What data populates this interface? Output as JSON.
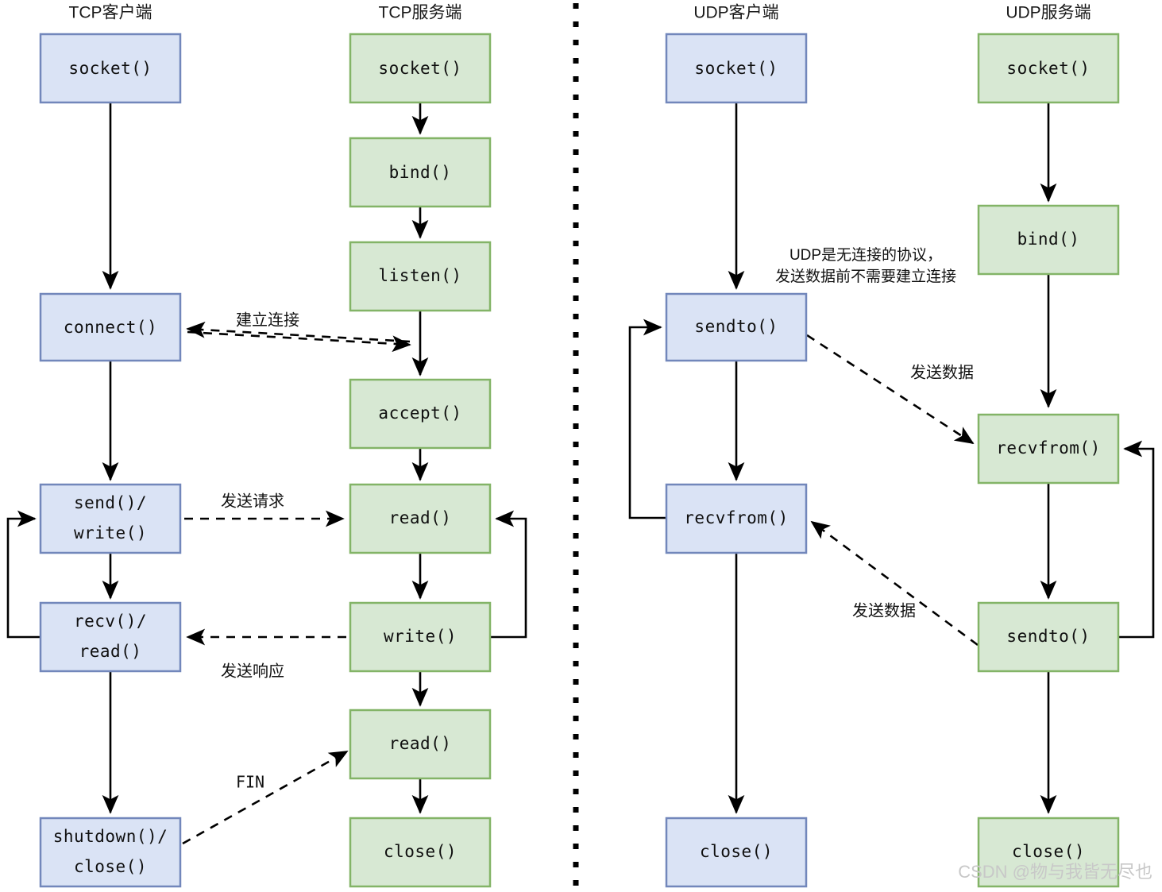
{
  "diagram": {
    "title_hidden": "TCP and UDP socket programming flow",
    "colors": {
      "blue_fill": "#dae3f5",
      "blue_stroke": "#7287bb",
      "green_fill": "#d7e8d3",
      "green_stroke": "#83b467",
      "line": "#000000",
      "watermark": "#c8c8c8"
    },
    "columns": [
      {
        "id": "tcp-client",
        "title": "TCP客户端",
        "color": "blue"
      },
      {
        "id": "tcp-server",
        "title": "TCP服务端",
        "color": "green"
      },
      {
        "id": "udp-client",
        "title": "UDP客户端",
        "color": "blue"
      },
      {
        "id": "udp-server",
        "title": "UDP服务端",
        "color": "green"
      }
    ],
    "nodes": {
      "tcp_client": [
        {
          "id": "tc-socket",
          "label": "socket()"
        },
        {
          "id": "tc-connect",
          "label": "connect()"
        },
        {
          "id": "tc-send",
          "label_line1": "send()/",
          "label_line2": "write()"
        },
        {
          "id": "tc-recv",
          "label_line1": "recv()/",
          "label_line2": "read()"
        },
        {
          "id": "tc-shutdown",
          "label_line1": "shutdown()/",
          "label_line2": "close()"
        }
      ],
      "tcp_server": [
        {
          "id": "ts-socket",
          "label": "socket()"
        },
        {
          "id": "ts-bind",
          "label": "bind()"
        },
        {
          "id": "ts-listen",
          "label": "listen()"
        },
        {
          "id": "ts-accept",
          "label": "accept()"
        },
        {
          "id": "ts-read1",
          "label": "read()"
        },
        {
          "id": "ts-write",
          "label": "write()"
        },
        {
          "id": "ts-read2",
          "label": "read()"
        },
        {
          "id": "ts-close",
          "label": "close()"
        }
      ],
      "udp_client": [
        {
          "id": "uc-socket",
          "label": "socket()"
        },
        {
          "id": "uc-sendto",
          "label": "sendto()"
        },
        {
          "id": "uc-recvfrom",
          "label": "recvfrom()"
        },
        {
          "id": "uc-close",
          "label": "close()"
        }
      ],
      "udp_server": [
        {
          "id": "us-socket",
          "label": "socket()"
        },
        {
          "id": "us-bind",
          "label": "bind()"
        },
        {
          "id": "us-recvfrom",
          "label": "recvfrom()"
        },
        {
          "id": "us-sendto",
          "label": "sendto()"
        },
        {
          "id": "us-close",
          "label": "close()"
        }
      ]
    },
    "edge_labels": {
      "establish_connection": "建立连接",
      "send_request": "发送请求",
      "send_response": "发送响应",
      "fin": "FIN",
      "send_data_1": "发送数据",
      "send_data_2": "发送数据"
    },
    "notes": {
      "udp_note_line1": "UDP是无连接的协议，",
      "udp_note_line2": "发送数据前不需要建立连接"
    },
    "watermark": "CSDN @物与我皆无尽也"
  }
}
